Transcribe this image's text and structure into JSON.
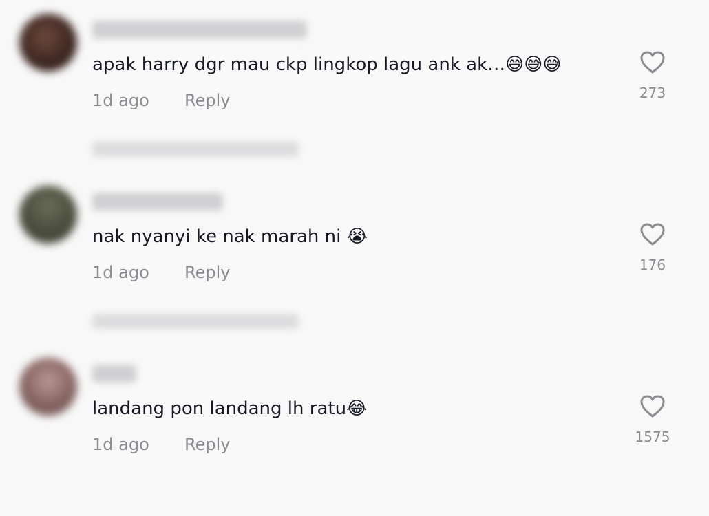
{
  "comments": [
    {
      "text": "apak harry dgr mau ckp lingkop lagu ank ak…😅😅😅",
      "time": "1d ago",
      "reply_label": "Reply",
      "likes": "273"
    },
    {
      "text": "nak nyanyi ke nak marah ni 😭",
      "time": "1d ago",
      "reply_label": "Reply",
      "likes": "176"
    },
    {
      "text": "landang pon landang lh ratu😂",
      "time": "1d ago",
      "reply_label": "Reply",
      "likes": "1575"
    }
  ],
  "icons": {
    "like": "heart-outline-icon"
  },
  "colors": {
    "background": "#f8f8f8",
    "text": "#161823",
    "secondary_text": "#8a8b91"
  }
}
